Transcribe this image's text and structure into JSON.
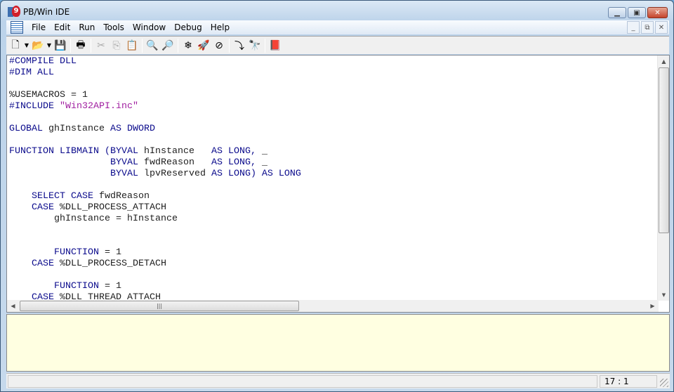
{
  "window": {
    "title": "PB/Win IDE",
    "app_icon": "powerbasic-icon",
    "caption_buttons": [
      "minimize",
      "maximize",
      "close"
    ]
  },
  "menu": {
    "items": [
      "File",
      "Edit",
      "Run",
      "Tools",
      "Window",
      "Debug",
      "Help"
    ],
    "mdi_buttons": [
      "minimize",
      "restore",
      "close"
    ]
  },
  "toolbar": {
    "buttons": [
      {
        "icon": "new-file-icon",
        "glyph": "🗋",
        "dropdown": true
      },
      {
        "icon": "open-folder-icon",
        "glyph": "📂",
        "dropdown": true
      },
      {
        "icon": "save-icon",
        "glyph": "💾"
      },
      {
        "sep": true
      },
      {
        "icon": "print-icon",
        "glyph": "🖶"
      },
      {
        "sep": true
      },
      {
        "icon": "cut-icon",
        "glyph": "✂",
        "disabled": true
      },
      {
        "icon": "copy-icon",
        "glyph": "⎘",
        "disabled": true
      },
      {
        "icon": "paste-icon",
        "glyph": "📋"
      },
      {
        "sep": true
      },
      {
        "icon": "find-icon",
        "glyph": "🔍"
      },
      {
        "icon": "replace-icon",
        "glyph": "🔎"
      },
      {
        "sep": true
      },
      {
        "icon": "compile-icon",
        "glyph": "❄"
      },
      {
        "icon": "compile-run-icon",
        "glyph": "🚀"
      },
      {
        "icon": "debug-stop-icon",
        "glyph": "⊘"
      },
      {
        "sep": true
      },
      {
        "icon": "step-into-icon",
        "glyph": "⤵"
      },
      {
        "icon": "binoculars-icon",
        "glyph": "🔭"
      },
      {
        "sep": true
      },
      {
        "icon": "help-book-icon",
        "glyph": "📕"
      }
    ]
  },
  "editor": {
    "lines": [
      [
        [
          "#COMPILE DLL",
          "kw"
        ]
      ],
      [
        [
          "#DIM ALL",
          "kw"
        ]
      ],
      [],
      [
        [
          "%USEMACROS = 1",
          ""
        ]
      ],
      [
        [
          "#INCLUDE ",
          "kw"
        ],
        [
          "\"Win32API.inc\"",
          "str"
        ]
      ],
      [],
      [
        [
          "GLOBAL ",
          "kw"
        ],
        [
          "ghInstance ",
          ""
        ],
        [
          "AS DWORD",
          "kw"
        ]
      ],
      [],
      [
        [
          "FUNCTION LIBMAIN (BYVAL ",
          "kw"
        ],
        [
          "hInstance   ",
          ""
        ],
        [
          "AS LONG, ",
          "kw"
        ],
        [
          "_",
          ""
        ]
      ],
      [
        [
          "                  BYVAL ",
          "kw"
        ],
        [
          "fwdReason   ",
          ""
        ],
        [
          "AS LONG, ",
          "kw"
        ],
        [
          "_",
          ""
        ]
      ],
      [
        [
          "                  BYVAL ",
          "kw"
        ],
        [
          "lpvReserved ",
          ""
        ],
        [
          "AS LONG) AS LONG",
          "kw"
        ]
      ],
      [],
      [
        [
          "    SELECT CASE ",
          "kw"
        ],
        [
          "fwdReason",
          ""
        ]
      ],
      [
        [
          "    CASE ",
          "kw"
        ],
        [
          "%DLL_PROCESS_ATTACH",
          ""
        ]
      ],
      [
        [
          "        ghInstance = hInstance",
          ""
        ]
      ],
      [],
      [],
      [
        [
          "        FUNCTION ",
          "kw"
        ],
        [
          "= 1",
          ""
        ]
      ],
      [
        [
          "    CASE ",
          "kw"
        ],
        [
          "%DLL_PROCESS_DETACH",
          ""
        ]
      ],
      [],
      [
        [
          "        FUNCTION ",
          "kw"
        ],
        [
          "= 1",
          ""
        ]
      ],
      [
        [
          "    CASE ",
          "kw"
        ],
        [
          "%DLL_THREAD_ATTACH",
          ""
        ]
      ]
    ]
  },
  "colors": {
    "keyword": "#0b0b8c",
    "string": "#a01ea0",
    "output_bg": "#ffffe1"
  },
  "status": {
    "position": "17 : 1"
  }
}
